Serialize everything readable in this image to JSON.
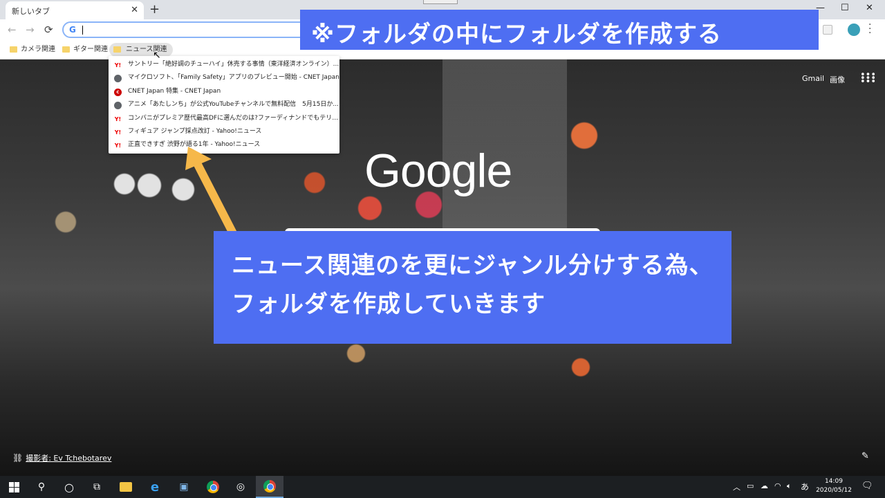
{
  "tab": {
    "title": "新しいタブ",
    "close": "✕",
    "new_tab": "+"
  },
  "window": {
    "minimize": "—",
    "maximize": "☐",
    "close": "✕"
  },
  "nav": {
    "back": "←",
    "forward": "→",
    "reload": "⟳"
  },
  "omnibox": {
    "g_icon": "G",
    "value": ""
  },
  "bookmarks": [
    {
      "label": "カメラ関連"
    },
    {
      "label": "ギター関連"
    },
    {
      "label": "ニュース関連"
    }
  ],
  "dropdown_items": [
    {
      "icon": "Y!",
      "icon_type": "yahoo",
      "label": "サントリー「絶好調のチューハイ」休売する事情（東洋経済オンライン）..."
    },
    {
      "icon": "",
      "icon_type": "globe",
      "label": "マイクロソフト、「Family Safety」アプリのプレビュー開始 - CNET Japan"
    },
    {
      "icon": "c",
      "icon_type": "cnet",
      "label": "CNET Japan 特集 - CNET Japan"
    },
    {
      "icon": "",
      "icon_type": "globe",
      "label": "アニメ「あたしンち」が公式YouTubeチャンネルで無料配信　5月15日か..."
    },
    {
      "icon": "Y!",
      "icon_type": "yahoo",
      "label": "コンバニがプレミア歴代最高DFに選んだのは?ファーディナンドでもテリーで..."
    },
    {
      "icon": "Y!",
      "icon_type": "yahoo",
      "label": "フィギュア ジャンプ採点改訂 - Yahoo!ニュース"
    },
    {
      "icon": "Y!",
      "icon_type": "yahoo",
      "label": "正直できすぎ 渋野が語る1年 - Yahoo!ニュース"
    }
  ],
  "ntp": {
    "gmail": "Gmail",
    "images": "画像",
    "logo": "Google",
    "photo_credit": "撮影者: Ev Tchebotarev"
  },
  "annotations": {
    "top_banner": "※フォルダの中にフォルダを作成する",
    "callout": "ニュース関連のを更にジャンル分けする為、フォルダを作成していきます"
  },
  "colors": {
    "banner": "#4e6ef2",
    "arrow": "#f6b84a"
  },
  "taskbar": {
    "ime": "あ",
    "time": "14:09",
    "date": "2020/05/12"
  }
}
